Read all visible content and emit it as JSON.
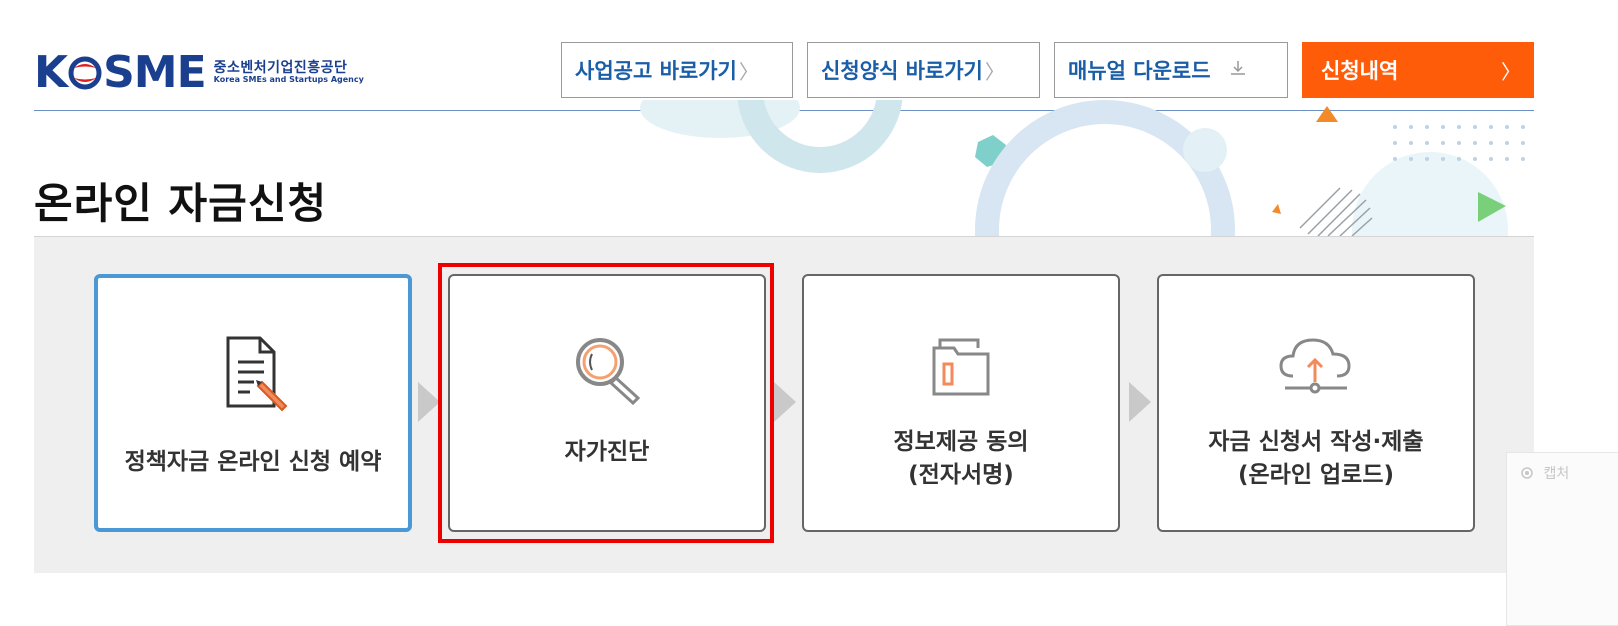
{
  "logo": {
    "mark": "KOSME",
    "name_kr": "중소벤처기업진흥공단",
    "name_en": "Korea SMEs and Startups Agency"
  },
  "header": {
    "buttons": [
      {
        "label": "사업공고 바로가기",
        "icon": "chevron-right-icon"
      },
      {
        "label": "신청양식 바로가기",
        "icon": "chevron-right-icon"
      },
      {
        "label": "매뉴얼 다운로드",
        "icon": "download-icon"
      },
      {
        "label": "신청내역",
        "icon": "chevron-right-icon"
      }
    ]
  },
  "page_title": "온라인 자금신청",
  "steps": [
    {
      "label": "정책자금 온라인 신청 예약",
      "icon": "document-pen-icon",
      "active": true
    },
    {
      "label": "자가진단",
      "icon": "magnifier-icon",
      "highlighted": true
    },
    {
      "label": "정보제공 동의\n(전자서명)",
      "icon": "folder-icon"
    },
    {
      "label": "자금 신청서 작성·제출\n(온라인 업로드)",
      "icon": "cloud-upload-icon"
    }
  ],
  "side_widget": {
    "label": "캡처",
    "icon": "capture-icon"
  },
  "colors": {
    "brand_blue": "#1b3f8f",
    "link_blue": "#1b5ea8",
    "accent_orange": "#ff5c0a",
    "active_border": "#4a98d6",
    "highlight_red": "#e00000"
  }
}
